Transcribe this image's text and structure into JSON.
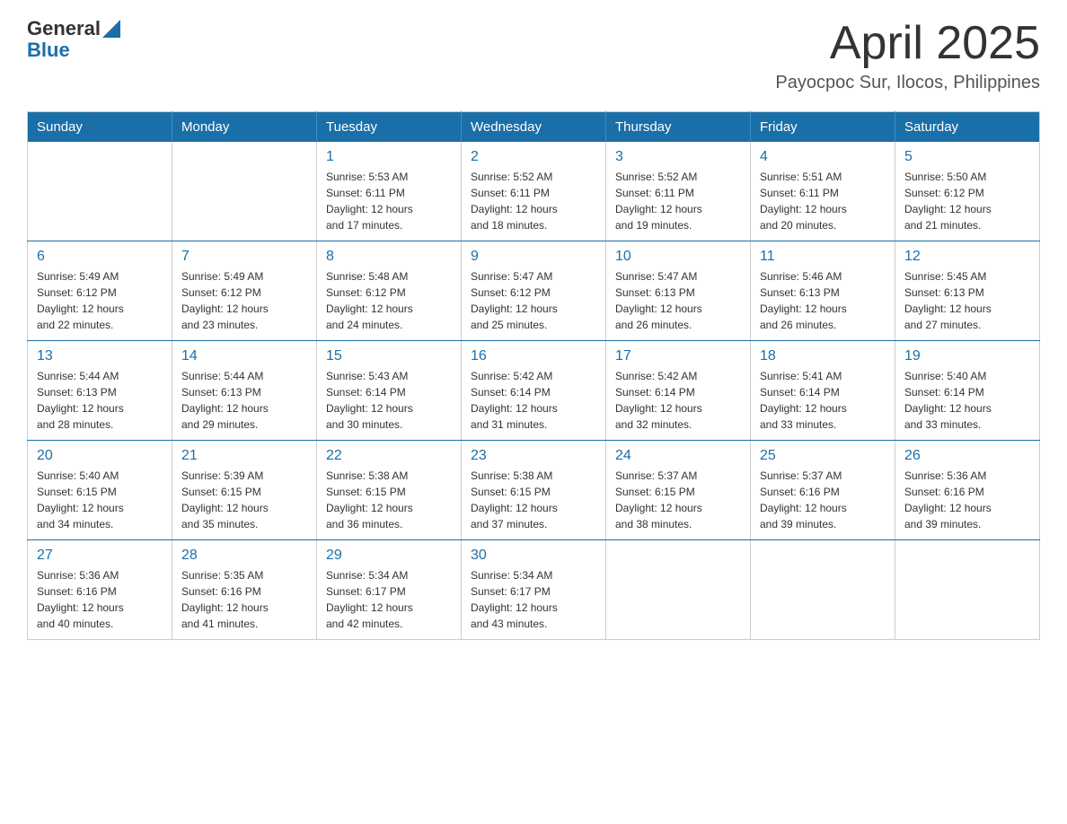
{
  "header": {
    "logo": {
      "general": "General",
      "blue": "Blue"
    },
    "title": "April 2025",
    "location": "Payocpoc Sur, Ilocos, Philippines"
  },
  "calendar": {
    "days_of_week": [
      "Sunday",
      "Monday",
      "Tuesday",
      "Wednesday",
      "Thursday",
      "Friday",
      "Saturday"
    ],
    "weeks": [
      [
        {
          "day": "",
          "info": ""
        },
        {
          "day": "",
          "info": ""
        },
        {
          "day": "1",
          "info": "Sunrise: 5:53 AM\nSunset: 6:11 PM\nDaylight: 12 hours\nand 17 minutes."
        },
        {
          "day": "2",
          "info": "Sunrise: 5:52 AM\nSunset: 6:11 PM\nDaylight: 12 hours\nand 18 minutes."
        },
        {
          "day": "3",
          "info": "Sunrise: 5:52 AM\nSunset: 6:11 PM\nDaylight: 12 hours\nand 19 minutes."
        },
        {
          "day": "4",
          "info": "Sunrise: 5:51 AM\nSunset: 6:11 PM\nDaylight: 12 hours\nand 20 minutes."
        },
        {
          "day": "5",
          "info": "Sunrise: 5:50 AM\nSunset: 6:12 PM\nDaylight: 12 hours\nand 21 minutes."
        }
      ],
      [
        {
          "day": "6",
          "info": "Sunrise: 5:49 AM\nSunset: 6:12 PM\nDaylight: 12 hours\nand 22 minutes."
        },
        {
          "day": "7",
          "info": "Sunrise: 5:49 AM\nSunset: 6:12 PM\nDaylight: 12 hours\nand 23 minutes."
        },
        {
          "day": "8",
          "info": "Sunrise: 5:48 AM\nSunset: 6:12 PM\nDaylight: 12 hours\nand 24 minutes."
        },
        {
          "day": "9",
          "info": "Sunrise: 5:47 AM\nSunset: 6:12 PM\nDaylight: 12 hours\nand 25 minutes."
        },
        {
          "day": "10",
          "info": "Sunrise: 5:47 AM\nSunset: 6:13 PM\nDaylight: 12 hours\nand 26 minutes."
        },
        {
          "day": "11",
          "info": "Sunrise: 5:46 AM\nSunset: 6:13 PM\nDaylight: 12 hours\nand 26 minutes."
        },
        {
          "day": "12",
          "info": "Sunrise: 5:45 AM\nSunset: 6:13 PM\nDaylight: 12 hours\nand 27 minutes."
        }
      ],
      [
        {
          "day": "13",
          "info": "Sunrise: 5:44 AM\nSunset: 6:13 PM\nDaylight: 12 hours\nand 28 minutes."
        },
        {
          "day": "14",
          "info": "Sunrise: 5:44 AM\nSunset: 6:13 PM\nDaylight: 12 hours\nand 29 minutes."
        },
        {
          "day": "15",
          "info": "Sunrise: 5:43 AM\nSunset: 6:14 PM\nDaylight: 12 hours\nand 30 minutes."
        },
        {
          "day": "16",
          "info": "Sunrise: 5:42 AM\nSunset: 6:14 PM\nDaylight: 12 hours\nand 31 minutes."
        },
        {
          "day": "17",
          "info": "Sunrise: 5:42 AM\nSunset: 6:14 PM\nDaylight: 12 hours\nand 32 minutes."
        },
        {
          "day": "18",
          "info": "Sunrise: 5:41 AM\nSunset: 6:14 PM\nDaylight: 12 hours\nand 33 minutes."
        },
        {
          "day": "19",
          "info": "Sunrise: 5:40 AM\nSunset: 6:14 PM\nDaylight: 12 hours\nand 33 minutes."
        }
      ],
      [
        {
          "day": "20",
          "info": "Sunrise: 5:40 AM\nSunset: 6:15 PM\nDaylight: 12 hours\nand 34 minutes."
        },
        {
          "day": "21",
          "info": "Sunrise: 5:39 AM\nSunset: 6:15 PM\nDaylight: 12 hours\nand 35 minutes."
        },
        {
          "day": "22",
          "info": "Sunrise: 5:38 AM\nSunset: 6:15 PM\nDaylight: 12 hours\nand 36 minutes."
        },
        {
          "day": "23",
          "info": "Sunrise: 5:38 AM\nSunset: 6:15 PM\nDaylight: 12 hours\nand 37 minutes."
        },
        {
          "day": "24",
          "info": "Sunrise: 5:37 AM\nSunset: 6:15 PM\nDaylight: 12 hours\nand 38 minutes."
        },
        {
          "day": "25",
          "info": "Sunrise: 5:37 AM\nSunset: 6:16 PM\nDaylight: 12 hours\nand 39 minutes."
        },
        {
          "day": "26",
          "info": "Sunrise: 5:36 AM\nSunset: 6:16 PM\nDaylight: 12 hours\nand 39 minutes."
        }
      ],
      [
        {
          "day": "27",
          "info": "Sunrise: 5:36 AM\nSunset: 6:16 PM\nDaylight: 12 hours\nand 40 minutes."
        },
        {
          "day": "28",
          "info": "Sunrise: 5:35 AM\nSunset: 6:16 PM\nDaylight: 12 hours\nand 41 minutes."
        },
        {
          "day": "29",
          "info": "Sunrise: 5:34 AM\nSunset: 6:17 PM\nDaylight: 12 hours\nand 42 minutes."
        },
        {
          "day": "30",
          "info": "Sunrise: 5:34 AM\nSunset: 6:17 PM\nDaylight: 12 hours\nand 43 minutes."
        },
        {
          "day": "",
          "info": ""
        },
        {
          "day": "",
          "info": ""
        },
        {
          "day": "",
          "info": ""
        }
      ]
    ]
  }
}
